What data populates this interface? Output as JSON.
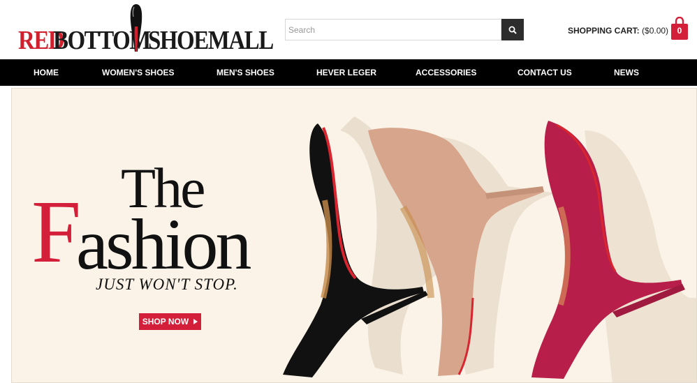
{
  "logo": {
    "part1": "RED",
    "part2": "BOTTOM",
    "part3": "SHOEMALL"
  },
  "search": {
    "placeholder": "Search",
    "icon": "search-icon"
  },
  "cart": {
    "label": "SHOPPING CART:",
    "total": "($0.00)",
    "count": "0",
    "icon": "shopping-bag-icon"
  },
  "nav": {
    "items": [
      {
        "label": "HOME"
      },
      {
        "label": "WOMEN'S SHOES"
      },
      {
        "label": "MEN'S SHOES"
      },
      {
        "label": "HEVER LEGER"
      },
      {
        "label": "ACCESSORIES"
      },
      {
        "label": "CONTACT US"
      },
      {
        "label": "NEWS"
      }
    ]
  },
  "banner": {
    "headline_the": "The",
    "headline_f": "F",
    "headline_ashion": "ashion",
    "subline": "JUST WON'T STOP.",
    "cta": "SHOP NOW",
    "cta_icon": "caret-right-icon"
  },
  "colors": {
    "brand_red": "#d41f3a",
    "nav_bg": "#000000",
    "banner_bg": "#fbf3e7"
  }
}
